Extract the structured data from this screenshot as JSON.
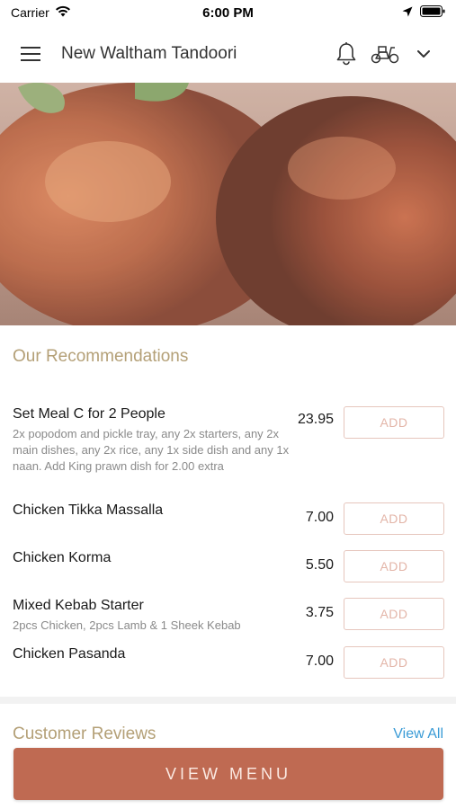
{
  "status_bar": {
    "carrier": "Carrier",
    "time": "6:00 PM"
  },
  "header": {
    "title": "New Waltham Tandoori",
    "icons": [
      "menu-icon",
      "bell-icon",
      "scooter-icon",
      "chevron-down-icon"
    ]
  },
  "hero": {
    "image": "tandoori-chicken-photo"
  },
  "recommendations": {
    "title": "Our Recommendations",
    "add_label": "ADD",
    "items": [
      {
        "name": "Set Meal C for 2 People",
        "description": "2x popodom and pickle tray, any 2x starters, any 2x main dishes, any 2x rice, any 1x side dish and any 1x naan. Add King prawn dish for 2.00 extra",
        "price": "23.95"
      },
      {
        "name": "Chicken Tikka Massalla",
        "description": "",
        "price": "7.00"
      },
      {
        "name": "Chicken Korma",
        "description": "",
        "price": "5.50"
      },
      {
        "name": "Mixed Kebab Starter",
        "description": "2pcs Chicken, 2pcs Lamb & 1 Sheek Kebab",
        "price": "3.75"
      },
      {
        "name": "Chicken Pasanda",
        "description": "",
        "price": "7.00"
      }
    ]
  },
  "reviews": {
    "title": "Customer Reviews",
    "view_all": "View All"
  },
  "bottom": {
    "view_menu_label": "VIEW MENU"
  },
  "colors": {
    "accent": "#bf6a52",
    "section_title": "#b4a077",
    "link": "#3a9bd6"
  }
}
